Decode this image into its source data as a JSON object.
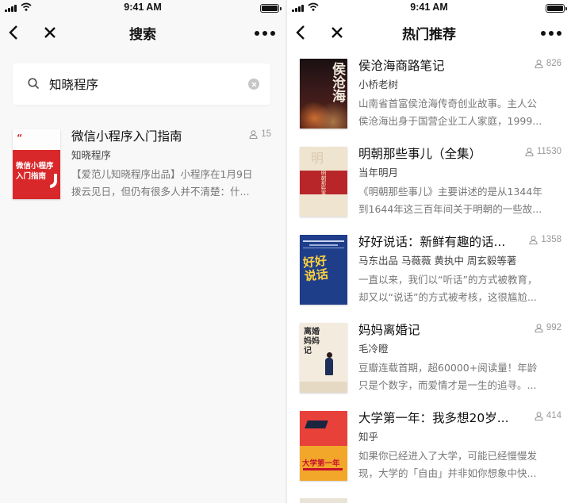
{
  "status_bar": {
    "time": "9:41 AM"
  },
  "left_screen": {
    "nav": {
      "title": "搜索"
    },
    "search": {
      "query": "知晓程序"
    },
    "results": [
      {
        "title": "微信小程序入门指南",
        "author": "知晓程序",
        "count": "15",
        "desc_line1": "【爱范儿知晓程序出品】小程序在1月9日",
        "desc_line2": "拨云见日，但仍有很多人并不清楚：什...",
        "cover_text_1": "微信小程序",
        "cover_text_2": "入门指南",
        "cover_quote": "“",
        "cover_color": "#d8282a"
      }
    ]
  },
  "right_screen": {
    "nav": {
      "title": "热门推荐"
    },
    "books": [
      {
        "title": "侯沧海商路笔记",
        "author": "小桥老树",
        "count": "826",
        "desc_line1": "山南省首富侯沧海传奇创业故事。主人公",
        "desc_line2": "侯沧海出身于国营企业工人家庭，1999...",
        "cover_text": "侯沧海"
      },
      {
        "title": "明朝那些事儿（全集）",
        "author": "当年明月",
        "count": "11530",
        "desc_line1": "《明朝那些事儿》主要讲述的是从1344年",
        "desc_line2": "到1644年这三百年间关于明朝的一些故...",
        "cover_text": "明朝那些事儿"
      },
      {
        "title": "好好说话：新鲜有趣的话...",
        "author": "马东出品 马薇薇 黄执中 周玄毅等著",
        "count": "1358",
        "desc_line1": "一直以来，我们以“听话”的方式被教育，",
        "desc_line2": "却又以“说话”的方式被考核，这很尴尬...",
        "cover_text": "好好说话"
      },
      {
        "title": "妈妈离婚记",
        "author": "毛冷瞪",
        "count": "992",
        "desc_line1": "豆瓣连载首期，超60000+阅读量！年龄",
        "desc_line2": "只是个数字，而爱情才是一生的追寻。...",
        "cover_text": "离婚妈妈记"
      },
      {
        "title": "大学第一年：我多想20岁...",
        "author": "知乎",
        "count": "414",
        "desc_line1": "如果你已经进入了大学，可能已经慢慢发",
        "desc_line2": "现，大学的「自由」并非如你想象中快...",
        "cover_text": "大学第一年"
      }
    ]
  },
  "colors": {
    "accent_red": "#d8282a",
    "count_gray": "#999999",
    "desc_gray": "#777777"
  },
  "icons": [
    "back-icon",
    "close-icon",
    "more-icon",
    "search-icon",
    "clear-icon",
    "person-icon"
  ]
}
